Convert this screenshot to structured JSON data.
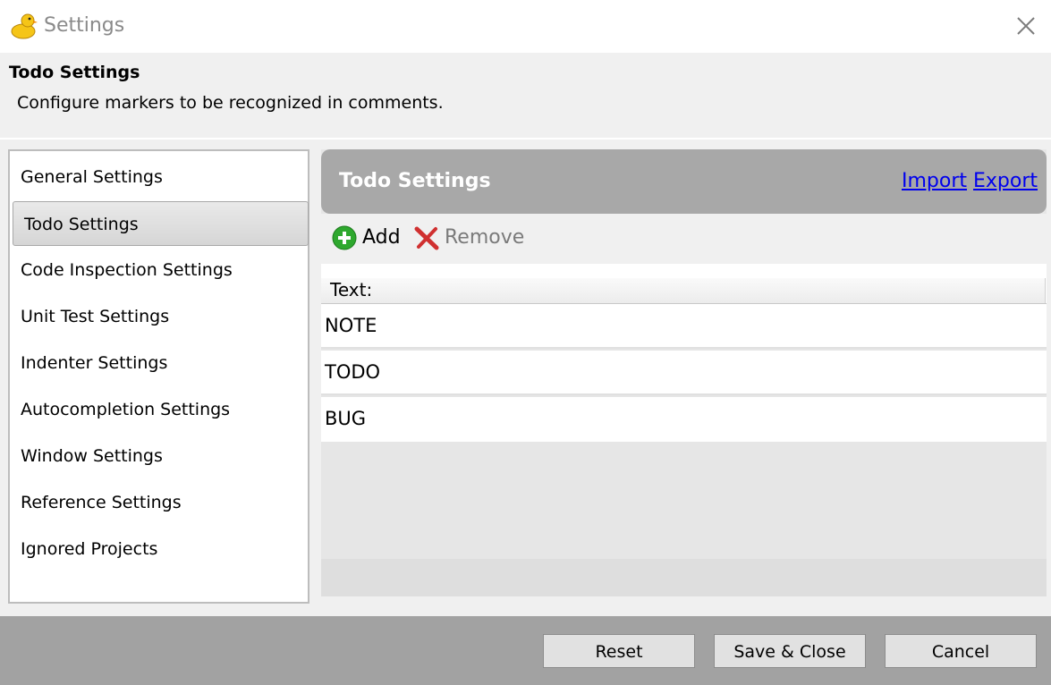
{
  "window": {
    "title": "Settings",
    "icon": "rubber-duck-icon",
    "close_icon": "close-icon"
  },
  "header": {
    "title": "Todo Settings",
    "description": "Configure markers to be recognized in comments."
  },
  "nav": {
    "selected_index": 1,
    "items": [
      {
        "label": "General Settings"
      },
      {
        "label": "Todo Settings"
      },
      {
        "label": "Code Inspection Settings"
      },
      {
        "label": "Unit Test Settings"
      },
      {
        "label": "Indenter Settings"
      },
      {
        "label": "Autocompletion Settings"
      },
      {
        "label": "Window Settings"
      },
      {
        "label": "Reference Settings"
      },
      {
        "label": "Ignored Projects"
      }
    ]
  },
  "panel": {
    "title": "Todo Settings",
    "import_label": "Import",
    "export_label": "Export",
    "toolbar": {
      "add_label": "Add",
      "add_icon": "plus-circle-icon",
      "remove_label": "Remove",
      "remove_icon": "red-x-icon"
    },
    "grid": {
      "column_header": "Text:",
      "rows": [
        {
          "text": "NOTE"
        },
        {
          "text": "TODO"
        },
        {
          "text": "BUG"
        }
      ]
    }
  },
  "footer": {
    "reset_label": "Reset",
    "save_close_label": "Save & Close",
    "cancel_label": "Cancel"
  },
  "colors": {
    "accent_link": "#0000ee",
    "panel_header": "#a8a8a8",
    "footer": "#a2a2a2",
    "add_icon_green": "#2ea82e",
    "remove_icon_red": "#d03030"
  }
}
